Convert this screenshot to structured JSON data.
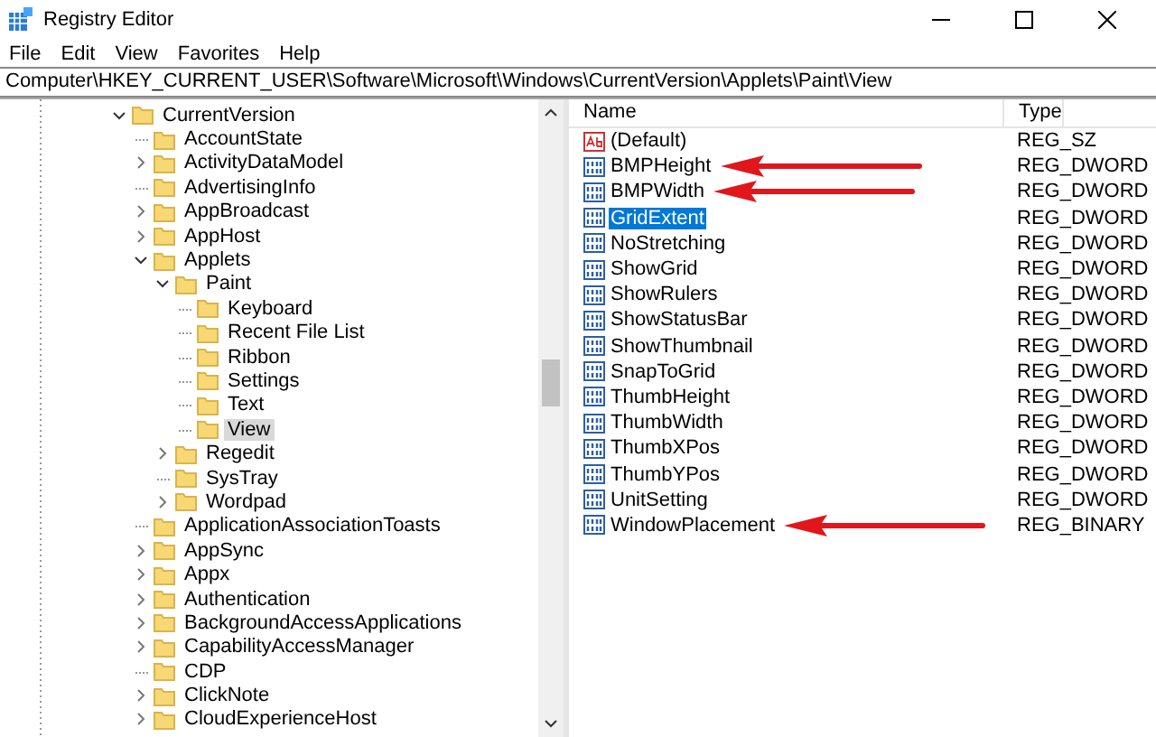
{
  "window": {
    "title": "Registry Editor"
  },
  "menu": [
    "File",
    "Edit",
    "View",
    "Favorites",
    "Help"
  ],
  "address": "Computer\\HKEY_CURRENT_USER\\Software\\Microsoft\\Windows\\CurrentVersion\\Applets\\Paint\\View",
  "tree": [
    {
      "label": "CurrentVersion",
      "kind": "open",
      "selected": false,
      "children": [
        {
          "label": "AccountState",
          "kind": "leaf",
          "selected": false
        },
        {
          "label": "ActivityDataModel",
          "kind": "closed",
          "selected": false
        },
        {
          "label": "AdvertisingInfo",
          "kind": "leaf",
          "selected": false
        },
        {
          "label": "AppBroadcast",
          "kind": "closed",
          "selected": false
        },
        {
          "label": "AppHost",
          "kind": "closed",
          "selected": false
        },
        {
          "label": "Applets",
          "kind": "open",
          "selected": false,
          "children": [
            {
              "label": "Paint",
              "kind": "open",
              "selected": false,
              "children": [
                {
                  "label": "Keyboard",
                  "kind": "leaf",
                  "selected": false
                },
                {
                  "label": "Recent File List",
                  "kind": "leaf",
                  "selected": false
                },
                {
                  "label": "Ribbon",
                  "kind": "leaf",
                  "selected": false
                },
                {
                  "label": "Settings",
                  "kind": "leaf",
                  "selected": false
                },
                {
                  "label": "Text",
                  "kind": "leaf",
                  "selected": false
                },
                {
                  "label": "View",
                  "kind": "leaf",
                  "selected": true
                }
              ]
            },
            {
              "label": "Regedit",
              "kind": "closed",
              "selected": false
            },
            {
              "label": "SysTray",
              "kind": "leaf",
              "selected": false
            },
            {
              "label": "Wordpad",
              "kind": "closed",
              "selected": false
            }
          ]
        },
        {
          "label": "ApplicationAssociationToasts",
          "kind": "leaf",
          "selected": false
        },
        {
          "label": "AppSync",
          "kind": "closed",
          "selected": false
        },
        {
          "label": "Appx",
          "kind": "closed",
          "selected": false
        },
        {
          "label": "Authentication",
          "kind": "closed",
          "selected": false
        },
        {
          "label": "BackgroundAccessApplications",
          "kind": "closed",
          "selected": false
        },
        {
          "label": "CapabilityAccessManager",
          "kind": "closed",
          "selected": false
        },
        {
          "label": "CDP",
          "kind": "leaf",
          "selected": false
        },
        {
          "label": "ClickNote",
          "kind": "closed",
          "selected": false
        },
        {
          "label": "CloudExperienceHost",
          "kind": "closed",
          "selected": false
        }
      ]
    }
  ],
  "values": {
    "columns": [
      "Name",
      "Type"
    ],
    "rows": [
      {
        "kind": "string",
        "name": "(Default)",
        "type": "REG_SZ",
        "selected": false,
        "arrow": false
      },
      {
        "kind": "binary",
        "name": "BMPHeight",
        "type": "REG_DWORD",
        "selected": false,
        "arrow": true
      },
      {
        "kind": "binary",
        "name": "BMPWidth",
        "type": "REG_DWORD",
        "selected": false,
        "arrow": true
      },
      {
        "kind": "binary",
        "name": "GridExtent",
        "type": "REG_DWORD",
        "selected": true,
        "arrow": false
      },
      {
        "kind": "binary",
        "name": "NoStretching",
        "type": "REG_DWORD",
        "selected": false,
        "arrow": false
      },
      {
        "kind": "binary",
        "name": "ShowGrid",
        "type": "REG_DWORD",
        "selected": false,
        "arrow": false
      },
      {
        "kind": "binary",
        "name": "ShowRulers",
        "type": "REG_DWORD",
        "selected": false,
        "arrow": false
      },
      {
        "kind": "binary",
        "name": "ShowStatusBar",
        "type": "REG_DWORD",
        "selected": false,
        "arrow": false
      },
      {
        "kind": "binary",
        "name": "ShowThumbnail",
        "type": "REG_DWORD",
        "selected": false,
        "arrow": false
      },
      {
        "kind": "binary",
        "name": "SnapToGrid",
        "type": "REG_DWORD",
        "selected": false,
        "arrow": false
      },
      {
        "kind": "binary",
        "name": "ThumbHeight",
        "type": "REG_DWORD",
        "selected": false,
        "arrow": false
      },
      {
        "kind": "binary",
        "name": "ThumbWidth",
        "type": "REG_DWORD",
        "selected": false,
        "arrow": false
      },
      {
        "kind": "binary",
        "name": "ThumbXPos",
        "type": "REG_DWORD",
        "selected": false,
        "arrow": false
      },
      {
        "kind": "binary",
        "name": "ThumbYPos",
        "type": "REG_DWORD",
        "selected": false,
        "arrow": false
      },
      {
        "kind": "binary",
        "name": "UnitSetting",
        "type": "REG_DWORD",
        "selected": false,
        "arrow": false
      },
      {
        "kind": "binary",
        "name": "WindowPlacement",
        "type": "REG_BINARY",
        "selected": false,
        "arrow": true
      }
    ]
  }
}
